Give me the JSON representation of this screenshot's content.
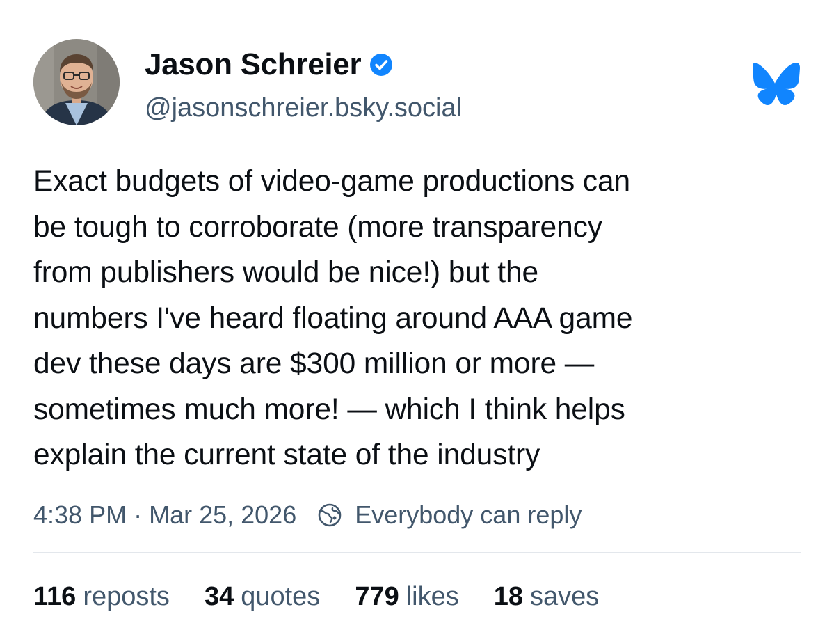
{
  "author": {
    "display_name": "Jason Schreier",
    "handle": "@jasonschreier.bsky.social",
    "verified": true
  },
  "post": {
    "text": "Exact budgets of video-game productions can\nbe tough to corroborate (more transparency\nfrom publishers would be nice!) but the\nnumbers I've heard floating around AAA game\ndev these days are $300 million or more —\nsometimes much more! — which I think helps\nexplain the current state of the industry",
    "time": "4:38 PM",
    "separator": "·",
    "date": "Mar 25, 2026",
    "reply_setting": "Everybody can reply"
  },
  "stats": {
    "reposts_count": "116",
    "reposts_label": "reposts",
    "quotes_count": "34",
    "quotes_label": "quotes",
    "likes_count": "779",
    "likes_label": "likes",
    "saves_count": "18",
    "saves_label": "saves"
  },
  "icons": {
    "verified": "verified-check-icon",
    "brand": "bluesky-butterfly-icon",
    "reply_setting": "globe-icon"
  },
  "colors": {
    "brand_blue": "#1185fe",
    "text_primary": "#0b0f14",
    "text_secondary": "#42576c",
    "divider": "#e3e7ec"
  }
}
